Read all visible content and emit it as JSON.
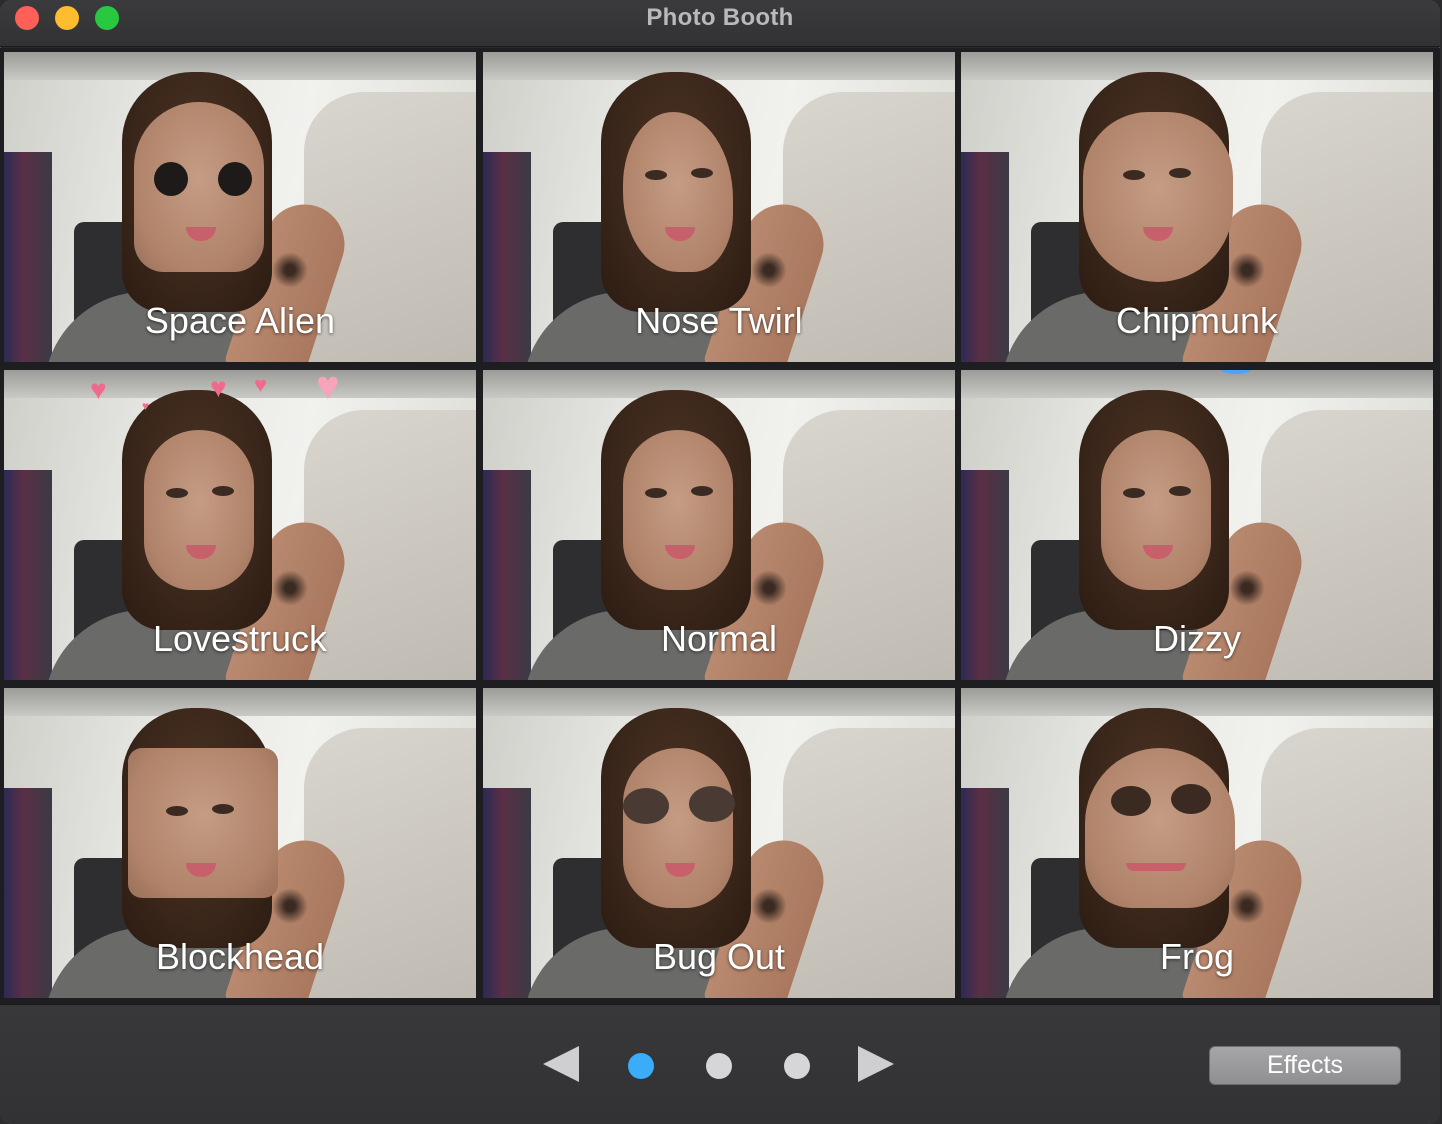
{
  "window": {
    "title": "Photo Booth",
    "traffic_lights": {
      "close": "#fe5f57",
      "minimize": "#febc2e",
      "maximize": "#28c840"
    }
  },
  "effects": [
    {
      "label": "Space Alien",
      "effect": "alien"
    },
    {
      "label": "Nose Twirl",
      "effect": "twirl"
    },
    {
      "label": "Chipmunk",
      "effect": "chipmunk"
    },
    {
      "label": "Lovestruck",
      "effect": "love"
    },
    {
      "label": "Normal",
      "effect": "normal"
    },
    {
      "label": "Dizzy",
      "effect": "dizzy"
    },
    {
      "label": "Blockhead",
      "effect": "block"
    },
    {
      "label": "Bug Out",
      "effect": "bug"
    },
    {
      "label": "Frog",
      "effect": "frog"
    }
  ],
  "pager": {
    "prev_icon": "left-triangle-arrow-icon",
    "next_icon": "right-triangle-arrow-icon",
    "pages": 3,
    "current_page": 1,
    "active_color": "#3aacf8"
  },
  "toolbar": {
    "effects_label": "Effects"
  }
}
